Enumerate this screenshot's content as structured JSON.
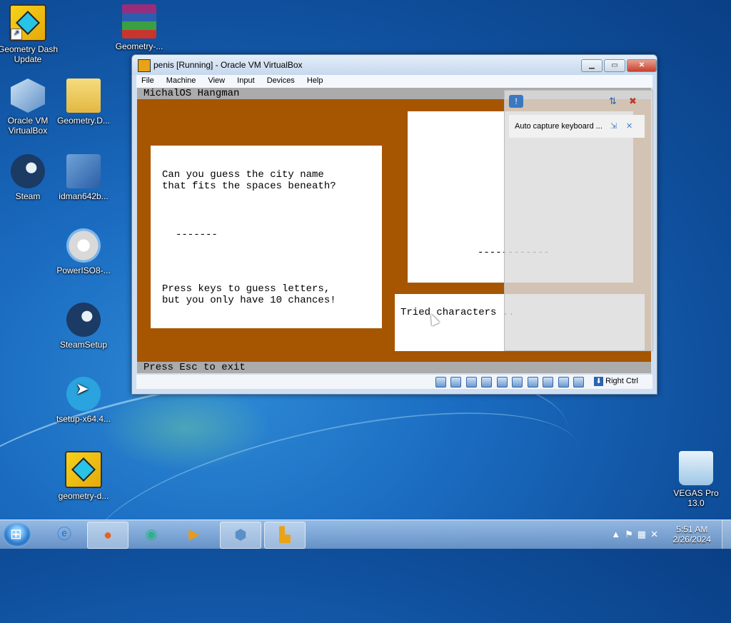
{
  "desktop": {
    "icons": [
      {
        "label": "Geometry Dash Update",
        "icon": "geometry-dash-icon"
      },
      {
        "label": "Geometry-...",
        "icon": "winrar-archive-icon"
      },
      {
        "label": "Oracle VM VirtualBox",
        "icon": "virtualbox-icon"
      },
      {
        "label": "Geometry.D...",
        "icon": "folder-icon"
      },
      {
        "label": "Steam",
        "icon": "steam-icon"
      },
      {
        "label": "idman642b...",
        "icon": "idm-installer-icon"
      },
      {
        "label": "PowerISO8-...",
        "icon": "poweriso-installer-icon"
      },
      {
        "label": "SteamSetup",
        "icon": "steam-setup-icon"
      },
      {
        "label": "tsetup-x64.4...",
        "icon": "telegram-icon"
      },
      {
        "label": "geometry-d...",
        "icon": "geometry-dash-icon"
      },
      {
        "label": "VEGAS Pro 13.0",
        "icon": "recycle-bin-icon"
      }
    ]
  },
  "vbox": {
    "title": "penis [Running] - Oracle VM VirtualBox",
    "menu": [
      "File",
      "Machine",
      "View",
      "Input",
      "Devices",
      "Help"
    ],
    "host_key": "Right Ctrl",
    "notification": "Auto capture keyboard ..."
  },
  "guest": {
    "top_bar": "MichalOS Hangman",
    "bottom_bar": "Press Esc to exit",
    "prompt": "Can you guess the city name\nthat fits the spaces beneath?",
    "blanks": "-------",
    "instructions": "Press keys to guess letters,\nbut you only have 10 chances!",
    "tried": "Tried characters ..",
    "gallows_line": "------------"
  },
  "taskbar": {
    "time": "5:51 AM",
    "date": "2/26/2024",
    "apps": [
      "internet-explorer-icon",
      "firefox-icon",
      "browser-icon",
      "media-player-icon",
      "virtualbox-icon",
      "michalos-vm-icon"
    ]
  },
  "colors": {
    "guest_bg": "#a65500",
    "desktop": "#1a6bc0"
  }
}
